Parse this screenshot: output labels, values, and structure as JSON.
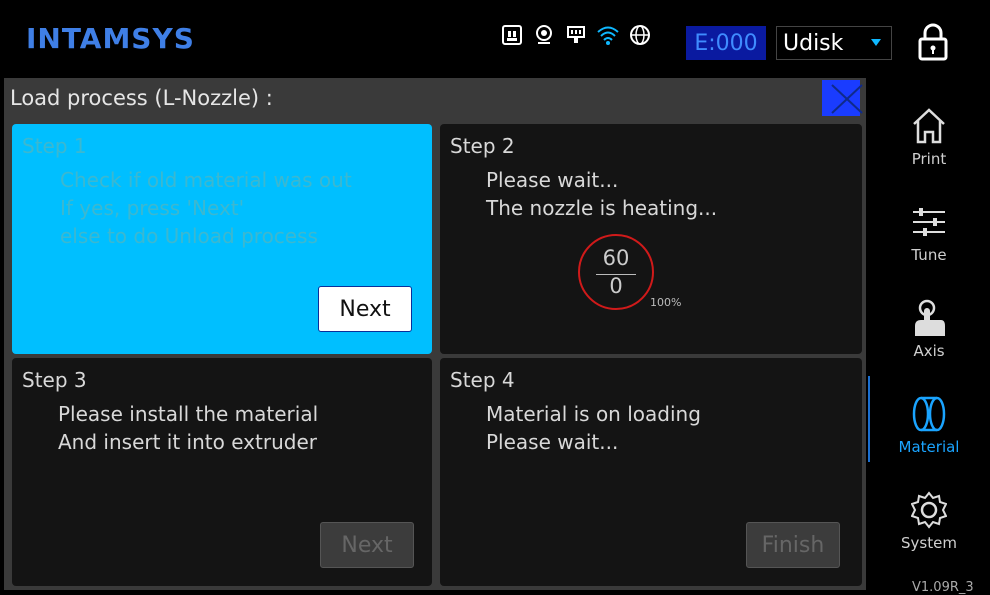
{
  "header": {
    "logo": "INTAMSYS",
    "error_code": "E:000",
    "storage_selected": "Udisk",
    "status_icons": [
      "sd-card-icon",
      "webcam-icon",
      "ethernet-icon",
      "wifi-icon",
      "globe-icon"
    ]
  },
  "panel": {
    "title": "Load process (L-Nozzle) :"
  },
  "steps": [
    {
      "title": "Step 1",
      "desc": "Check if old material was out\nIf yes, press 'Next'\nelse to do Unload process",
      "button": "Next",
      "active": true,
      "button_enabled": true
    },
    {
      "title": "Step 2",
      "desc": "Please wait...\nThe nozzle is heating...",
      "active": false
    },
    {
      "title": "Step 3",
      "desc": "Please install the material\nAnd insert it into extruder",
      "button": "Next",
      "active": false,
      "button_enabled": false
    },
    {
      "title": "Step 4",
      "desc": "Material is on loading\nPlease wait...",
      "button": "Finish",
      "active": false,
      "button_enabled": false
    }
  ],
  "heater": {
    "target": "60",
    "current": "0",
    "percent": "100%"
  },
  "sidebar": {
    "items": [
      {
        "label": "Print",
        "icon": "home-icon"
      },
      {
        "label": "Tune",
        "icon": "sliders-icon"
      },
      {
        "label": "Axis",
        "icon": "hand-pointer-icon"
      },
      {
        "label": "Material",
        "icon": "filament-icon",
        "selected": true
      },
      {
        "label": "System",
        "icon": "gear-icon"
      }
    ],
    "version": "V1.09R_3"
  },
  "colors": {
    "accent": "#00bfff",
    "logo": "#3f7fe6",
    "close_button": "#1a3cff",
    "selected_nav": "#1aa4ff"
  }
}
